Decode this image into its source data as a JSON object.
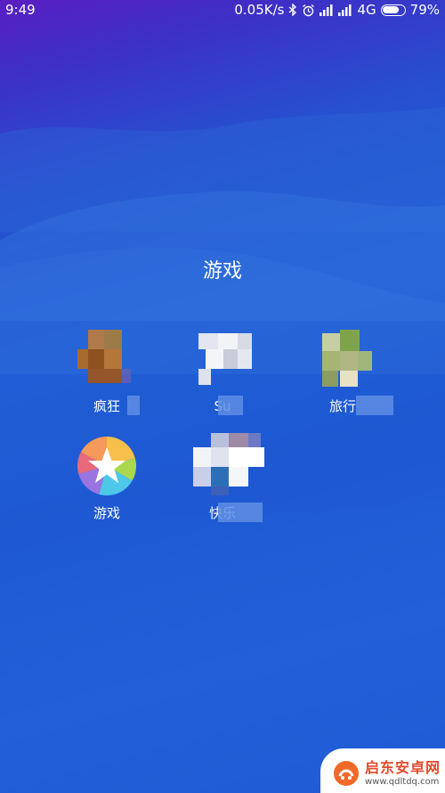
{
  "status_bar": {
    "time": "9:49",
    "network_speed": "0.05K/s",
    "network_type": "4G",
    "battery_percent": "79%",
    "battery_level": 0.79,
    "icons": [
      "bluetooth-icon",
      "alarm-icon",
      "signal-icon",
      "signal-icon",
      "battery-icon"
    ]
  },
  "folder": {
    "title": "游戏",
    "apps": [
      {
        "label": "疯狂",
        "icon": "blurred-app-icon"
      },
      {
        "label": "Su",
        "icon": "blurred-app-icon"
      },
      {
        "label": "旅行",
        "icon": "blurred-app-icon"
      },
      {
        "label": "游戏",
        "icon": "game-center-star-icon"
      },
      {
        "label": "快乐",
        "icon": "blurred-app-icon"
      }
    ]
  },
  "watermark": {
    "title": "启东安卓网",
    "url": "www.qdltdq.com"
  },
  "colors": {
    "background_top": "#5a1ec2",
    "background_bottom": "#1f59d3"
  }
}
